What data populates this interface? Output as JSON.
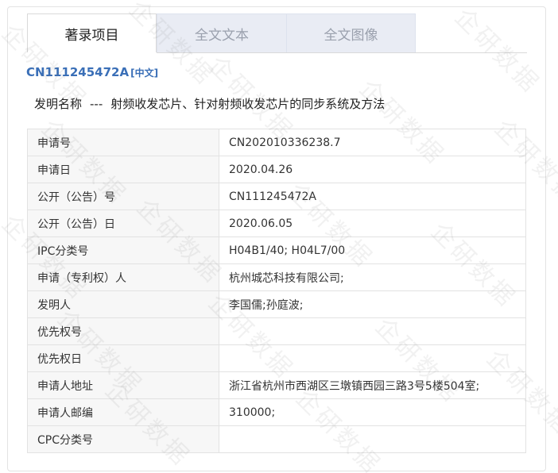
{
  "tabs": [
    {
      "label": "著录项目",
      "active": true
    },
    {
      "label": "全文文本",
      "active": false
    },
    {
      "label": "全文图像",
      "active": false
    }
  ],
  "patent": {
    "id": "CN111245472A",
    "lang_badge": "[中文]"
  },
  "title": {
    "label": "发明名称",
    "separator": "---",
    "text": "射频收发芯片、针对射频收发芯片的同步系统及方法"
  },
  "fields": [
    {
      "label": "申请号",
      "value": "CN202010336238.7"
    },
    {
      "label": "申请日",
      "value": "2020.04.26"
    },
    {
      "label": "公开（公告）号",
      "value": "CN111245472A"
    },
    {
      "label": "公开（公告）日",
      "value": "2020.06.05"
    },
    {
      "label": "IPC分类号",
      "value": "H04B1/40; H04L7/00"
    },
    {
      "label": "申请（专利权）人",
      "value": "杭州城芯科技有限公司;"
    },
    {
      "label": "发明人",
      "value": "李国儒;孙庭波;"
    },
    {
      "label": "优先权号",
      "value": ""
    },
    {
      "label": "优先权日",
      "value": ""
    },
    {
      "label": "申请人地址",
      "value": "浙江省杭州市西湖区三墩镇西园三路3号5楼504室;"
    },
    {
      "label": "申请人邮编",
      "value": "310000;"
    },
    {
      "label": "CPC分类号",
      "value": ""
    }
  ],
  "watermark": "企研数据",
  "colors": {
    "accent": "#3a6fb7",
    "tab_inactive_bg": "#e9ecf4",
    "label_bg": "#f7f7f7"
  }
}
